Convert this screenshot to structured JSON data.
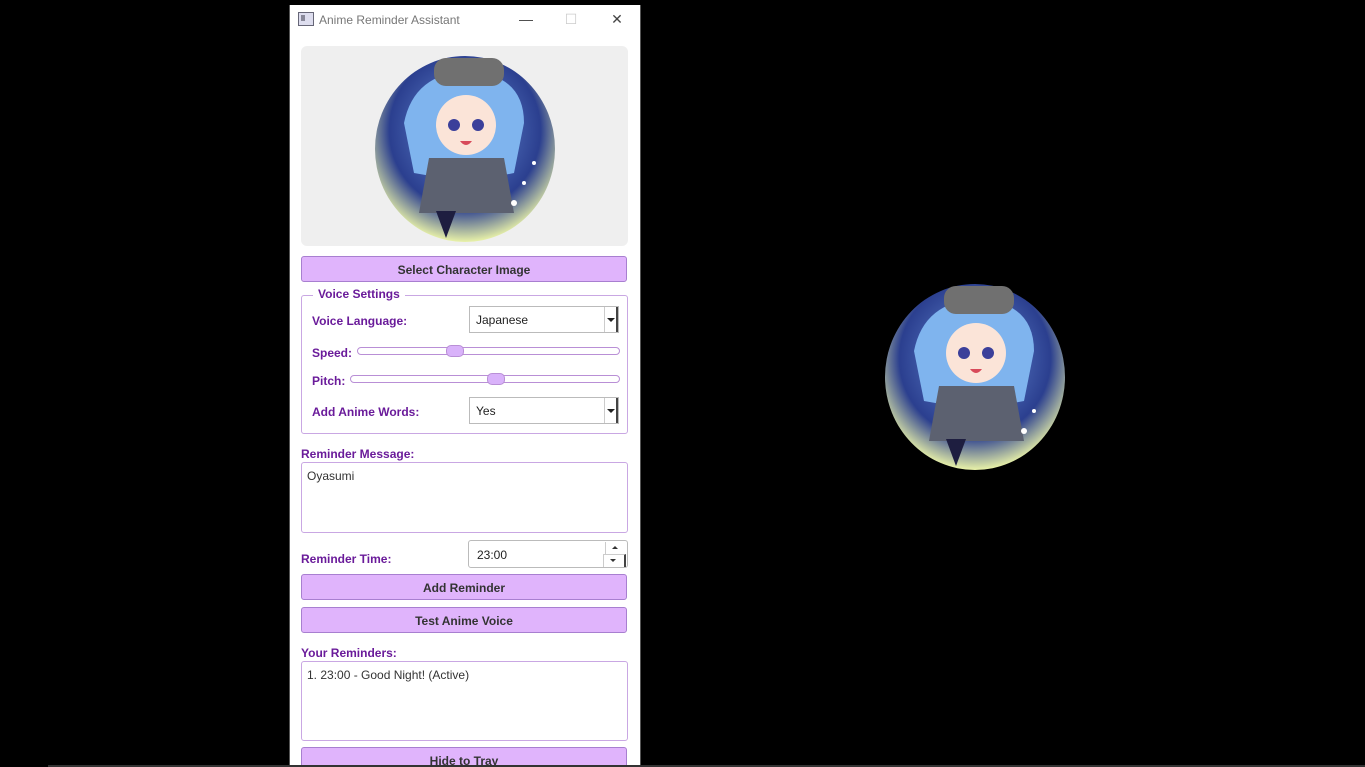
{
  "window": {
    "title": "Anime Reminder Assistant",
    "minimize": "—",
    "maximize": "☐",
    "close": "✕"
  },
  "buttons": {
    "select_image": "Select Character Image",
    "add_reminder": "Add Reminder",
    "test_voice": "Test Anime Voice",
    "hide_tray": "Hide to Tray"
  },
  "voice_settings": {
    "title": "Voice Settings",
    "language_label": "Voice Language:",
    "language_value": "Japanese",
    "speed_label": "Speed:",
    "speed_level": 0.36,
    "pitch_label": "Pitch:",
    "pitch_level": 0.54,
    "anime_words_label": "Add Anime Words:",
    "anime_words_value": "Yes"
  },
  "reminder": {
    "message_label": "Reminder Message:",
    "message_value": "Oyasumi",
    "time_label": "Reminder Time:",
    "time_value": "23:00"
  },
  "reminders_list": {
    "label": "Your Reminders:",
    "items": [
      "1. 23:00 - Good Night! (Active)"
    ]
  },
  "colors": {
    "accent": "#e0b4fc",
    "label": "#6a1b9a",
    "border": "#c9a7e3"
  }
}
